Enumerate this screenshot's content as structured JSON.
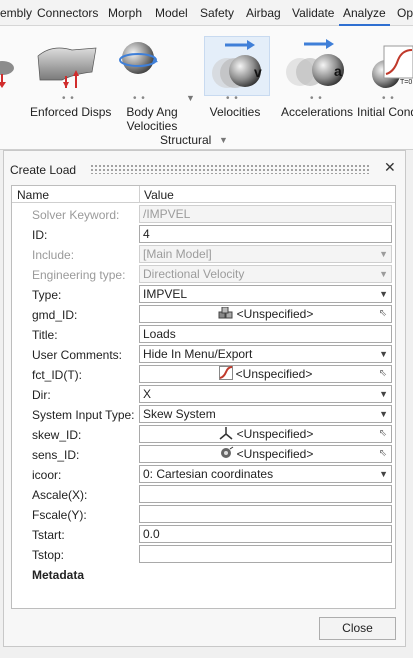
{
  "menu": {
    "items": [
      "embly",
      "Connectors",
      "Morph",
      "Model",
      "Safety",
      "Airbag",
      "Validate",
      "Analyze",
      "Opt"
    ],
    "active": "Analyze"
  },
  "ribbon": {
    "tools": [
      {
        "label": "Enforced Disps",
        "icon": "enforced-disps-icon"
      },
      {
        "label": "Body Ang\nVelocities",
        "icon": "body-ang-velocities-icon"
      },
      {
        "label": "Velocities",
        "icon": "velocities-icon"
      },
      {
        "label": "Accelerations",
        "icon": "accelerations-icon"
      },
      {
        "label": "Initial Conditi",
        "icon": "initial-conditions-icon"
      }
    ],
    "group_label": "Structural",
    "dots": "• •"
  },
  "dialog": {
    "title": "Create Load",
    "close_glyph": "✕",
    "header": {
      "name": "Name",
      "value": "Value"
    },
    "rows": [
      {
        "label": "Solver Keyword:",
        "value": "/IMPVEL",
        "kind": "text",
        "disabled": true
      },
      {
        "label": "ID:",
        "value": "4",
        "kind": "text",
        "disabled": false
      },
      {
        "label": "Include:",
        "value": "[Main Model]",
        "kind": "combo",
        "disabled": true
      },
      {
        "label": "Engineering type:",
        "value": "Directional Velocity",
        "kind": "combo",
        "disabled": true
      },
      {
        "label": "Type:",
        "value": "IMPVEL",
        "kind": "combo",
        "disabled": false
      },
      {
        "label": "gmd_ID:",
        "value": "<Unspecified>",
        "kind": "entity",
        "icon": "node-group-icon",
        "disabled": false
      },
      {
        "label": "Title:",
        "value": "Loads",
        "kind": "text",
        "disabled": false
      },
      {
        "label": "User Comments:",
        "value": "Hide In Menu/Export",
        "kind": "combo",
        "disabled": false
      },
      {
        "label": "fct_ID(T):",
        "value": "<Unspecified>",
        "kind": "entity",
        "icon": "curve-icon",
        "disabled": false
      },
      {
        "label": "Dir:",
        "value": "X",
        "kind": "combo",
        "disabled": false
      },
      {
        "label": "System Input Type:",
        "value": "Skew System",
        "kind": "combo",
        "disabled": false
      },
      {
        "label": "skew_ID:",
        "value": "<Unspecified>",
        "kind": "entity",
        "icon": "system-icon",
        "disabled": false
      },
      {
        "label": "sens_ID:",
        "value": "<Unspecified>",
        "kind": "entity",
        "icon": "sensor-icon",
        "disabled": false
      },
      {
        "label": "icoor:",
        "value": "0: Cartesian coordinates",
        "kind": "combo",
        "disabled": false
      },
      {
        "label": "Ascale(X):",
        "value": "",
        "kind": "text",
        "disabled": false
      },
      {
        "label": "Fscale(Y):",
        "value": "",
        "kind": "text",
        "disabled": false
      },
      {
        "label": "Tstart:",
        "value": "0.0",
        "kind": "text",
        "disabled": false
      },
      {
        "label": "Tstop:",
        "value": "",
        "kind": "text",
        "disabled": false
      }
    ],
    "metadata_label": "Metadata",
    "close_label": "Close"
  },
  "colors": {
    "accent": "#2f6fd1",
    "curve": "#c0392b"
  }
}
